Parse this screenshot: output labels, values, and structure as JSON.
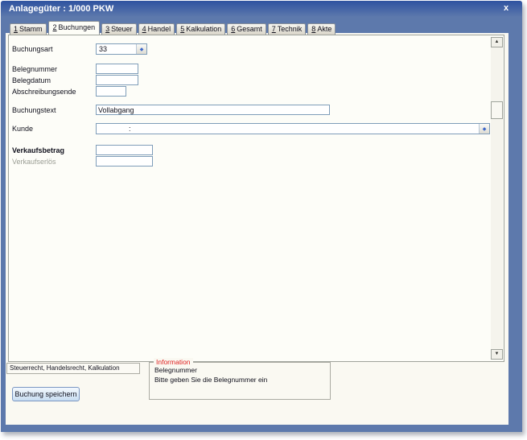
{
  "window": {
    "title": "Anlagegüter : 1/000 PKW",
    "close_glyph": "x"
  },
  "tabs": [
    {
      "num": "1",
      "label": "Stamm"
    },
    {
      "num": "2",
      "label": "Buchungen"
    },
    {
      "num": "3",
      "label": "Steuer"
    },
    {
      "num": "4",
      "label": "Handel"
    },
    {
      "num": "5",
      "label": "Kalkulation"
    },
    {
      "num": "6",
      "label": "Gesamt"
    },
    {
      "num": "7",
      "label": "Technik"
    },
    {
      "num": "8",
      "label": "Akte"
    }
  ],
  "active_tab": "2 Buchungen",
  "form": {
    "buchungsart": {
      "label": "Buchungsart",
      "value": "33"
    },
    "belegnummer": {
      "label": "Belegnummer",
      "value": ""
    },
    "belegdatum": {
      "label": "Belegdatum",
      "value": ""
    },
    "abschreibungsende": {
      "label": "Abschreibungsende",
      "value": ""
    },
    "buchungstext": {
      "label": "Buchungstext",
      "value": "Vollabgang"
    },
    "kunde": {
      "label": "Kunde",
      "value": ":"
    },
    "verkaufsbetrag": {
      "label": "Verkaufsbetrag",
      "value": ""
    },
    "verkaufserloes": {
      "label": "Verkaufserlös",
      "value": "",
      "disabled": true
    }
  },
  "footer": {
    "rights_summary": "Steuerrecht, Handelsrecht, Kalkulation",
    "save_button_label": "Buchung speichern",
    "info": {
      "title": "Information",
      "line1": "Belegnummer",
      "line2": "Bitte geben Sie die Belegnummer ein"
    }
  },
  "icons": {
    "dropdown_glyph": "◆",
    "scroll_up_glyph": "▲",
    "scroll_down_glyph": "▼"
  },
  "colors": {
    "frame_blue": "#5d79ac",
    "titlebar_top": "#2e52a0",
    "info_title_red": "#de2020",
    "input_border": "#7f9db9"
  }
}
